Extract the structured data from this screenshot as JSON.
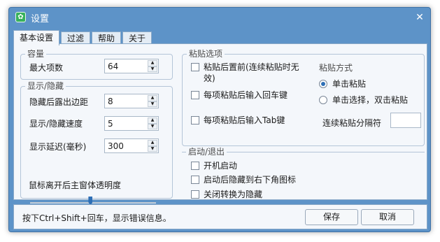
{
  "window": {
    "title": "设置",
    "icon": "gear-icon",
    "accent": "#5d93c8",
    "close_icon": "close-icon"
  },
  "tabs": [
    "基本设置",
    "过滤",
    "帮助",
    "关于"
  ],
  "active_tab": "基本设置",
  "capacity": {
    "title": "容量",
    "max_items_label": "最大项数",
    "max_items_value": "64"
  },
  "display": {
    "title": "显示/隐藏",
    "margin_label": "隐藏后露出边距",
    "margin_value": "8",
    "speed_label": "显示/隐藏速度",
    "speed_value": "5",
    "delay_label": "显示延迟(毫秒)",
    "delay_value": "300",
    "opacity_label": "鼠标离开后主窗体透明度",
    "opacity_level": 0.48
  },
  "paste": {
    "title": "粘贴选项",
    "move_front_label": "粘贴后置前(连续粘贴时无效)",
    "enter_label": "每项粘贴后输入回车键",
    "tab_label": "每项粘贴后输入Tab键",
    "mode_title": "粘贴方式",
    "mode_single": "单击粘贴",
    "mode_double": "单击选择，双击粘贴",
    "selected_mode": "单击粘贴",
    "separator_label": "连续粘贴分隔符",
    "separator_value": ""
  },
  "startup": {
    "title": "启动/退出",
    "autostart_label": "开机启动",
    "tray_label": "启动后隐藏到右下角图标",
    "close_hide_label": "关闭转换为隐藏"
  },
  "status": {
    "message": "按下Ctrl+Shift+回车，显示错误信息。",
    "save_label": "保存",
    "cancel_label": "取消"
  }
}
